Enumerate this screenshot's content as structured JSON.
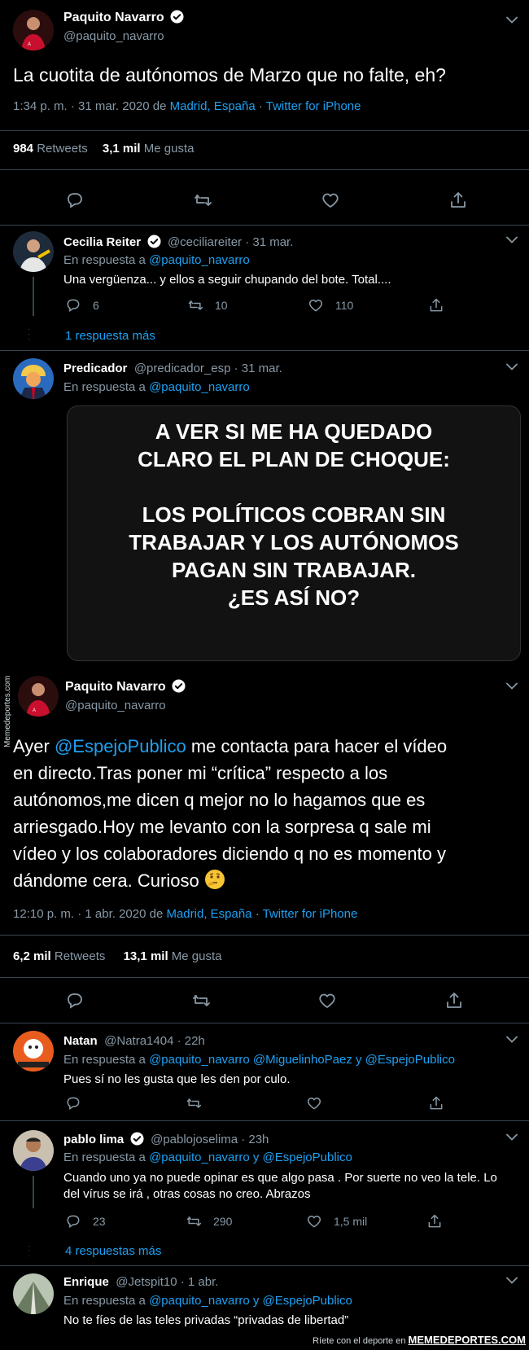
{
  "tweet1": {
    "author": "Paquito Navarro",
    "handle": "@paquito_navarro",
    "text": "La cuotita de autónomos de Marzo que no falte, eh?",
    "time": "1:34 p. m. · 31 mar. 2020 de ",
    "location": "Madrid, España",
    "sep": " · ",
    "client": "Twitter for iPhone",
    "retweets_count": "984",
    "retweets_label": "Retweets",
    "likes_count": "3,1 mil",
    "likes_label": "Me gusta"
  },
  "reply1": {
    "author": "Cecilia Reiter",
    "meta": "@ceciliareiter · 31 mar.",
    "in_reply_prefix": "En respuesta a ",
    "in_reply_to": "@paquito_navarro",
    "text": "Una vergüenza... y ellos a seguir chupando del bote. Total....",
    "replies": "6",
    "retweets": "10",
    "likes": "110",
    "more": "1 respuesta más"
  },
  "reply2": {
    "author": "Predicador",
    "meta": "@predicador_esp · 31 mar.",
    "in_reply_prefix": "En respuesta a ",
    "in_reply_to": "@paquito_navarro",
    "image_lines": [
      "A VER SI ME HA QUEDADO",
      "CLARO EL PLAN DE CHOQUE:",
      "",
      "LOS POLÍTICOS COBRAN SIN",
      "TRABAJAR Y LOS AUTÓNOMOS",
      "PAGAN SIN TRABAJAR.",
      "¿ES ASÍ NO?"
    ]
  },
  "watermark": "Memedeportes.com",
  "tweet2": {
    "author": "Paquito Navarro",
    "handle": "@paquito_navarro",
    "mention": "@EspejoPublico",
    "text_lines": [
      "Ayer ",
      "me contacta para hacer el vídeo",
      "en directo.Tras poner mi “crítica” respecto a los",
      "autónomos,me dicen q mejor no lo hagamos que es",
      "arriesgado.Hoy me levanto con la sorpresa q sale mi",
      "vídeo y los colaboradores diciendo q no es momento y",
      "dándome cera. Curioso"
    ],
    "emoji": "🤔",
    "time": "12:10 p. m. · 1 abr. 2020 de ",
    "location": "Madrid, España",
    "sep": " · ",
    "client": "Twitter for iPhone",
    "retweets_count": "6,2 mil",
    "retweets_label": "Retweets",
    "likes_count": "13,1 mil",
    "likes_label": "Me gusta"
  },
  "reply3": {
    "author": "Natan",
    "meta": "@Natra1404 · 22h",
    "in_reply_prefix": "En respuesta a ",
    "in_reply_to": "@paquito_navarro @MiguelinhoPaez y @EspejoPublico",
    "text": "Pues sí no les gusta que les den por culo."
  },
  "reply4": {
    "author": "pablo lima",
    "meta": "@pablojoselima · 23h",
    "in_reply_prefix": "En respuesta a ",
    "in_reply_to": "@paquito_navarro y @EspejoPublico",
    "text_lines": [
      "Cuando uno ya no puede opinar es que algo pasa . Por suerte no veo la tele. Lo",
      "del vírus se irá , otras cosas no creo. Abrazos"
    ],
    "replies": "23",
    "retweets": "290",
    "likes": "1,5 mil",
    "more": "4 respuestas más"
  },
  "reply5": {
    "author": "Enrique",
    "meta": "@Jetspit10 · 1 abr.",
    "in_reply_prefix": "En respuesta a ",
    "in_reply_to": "@paquito_navarro y @EspejoPublico",
    "text": "No te fíes de las teles privadas “privadas de libertad”"
  },
  "footer": {
    "tagline": "Ríete con el deporte en",
    "brand": "MEMEDEPORTES.COM"
  }
}
